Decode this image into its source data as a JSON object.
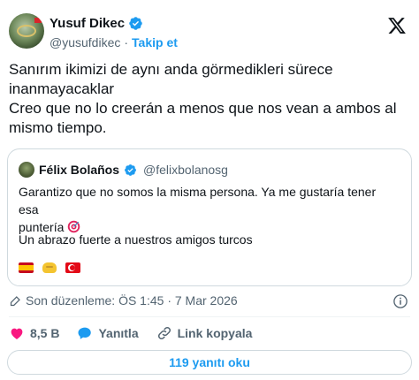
{
  "author": {
    "display_name": "Yusuf Dikec",
    "handle": "@yusufdikec",
    "separator": "·",
    "follow_label": "Takip et"
  },
  "tweet": {
    "text": "Sanırım ikimizi de aynı anda görmedikleri sürece\ninanmayacaklar\nCreo que no lo creerán a menos que nos vean a ambos al\nmismo tiempo."
  },
  "quote": {
    "display_name": "Félix Bolaños",
    "handle": "@felixbolanosg",
    "line1_part1": "Garantizo que no somos la misma persona. Ya me gustaría tener esa",
    "line1_part2": "puntería",
    "line2": "Un abrazo fuerte a nuestros amigos turcos"
  },
  "edited": {
    "label": "Son düzenleme: ÖS 1:45 · 7 Mar 2026"
  },
  "actions": {
    "likes": "8,5 B",
    "reply_label": "Yanıtla",
    "copy_link_label": "Link kopyala"
  },
  "replies_button": {
    "label": "119 yanıtı oku"
  },
  "colors": {
    "accent": "#1d9bf0",
    "like": "#f91880",
    "text": "#0f1419",
    "secondary": "#536471"
  },
  "icons": [
    "verified-badge-icon",
    "x-logo-icon",
    "target-emoji-icon",
    "spain-flag-icon",
    "handshake-icon",
    "turkey-flag-icon",
    "pencil-icon",
    "info-icon",
    "heart-icon",
    "reply-bubble-icon",
    "link-icon"
  ]
}
